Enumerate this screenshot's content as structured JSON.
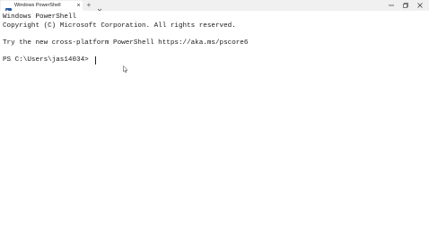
{
  "tab": {
    "title": "Windows PowerShell",
    "close_glyph": "×"
  },
  "tabbar": {
    "new_tab_glyph": "+"
  },
  "console": {
    "lines": [
      "Windows PowerShell",
      "Copyright (C) Microsoft Corporation. All rights reserved.",
      "Try the new cross-platform PowerShell https://aka.ms/pscore6",
      "PS C:\\Users\\jas14034> "
    ]
  },
  "icons": {
    "tab": "powershell-icon",
    "new_tab": "plus-icon",
    "dropdown": "chevron-down-icon",
    "minimize": "minimize-icon",
    "maximize": "maximize-icon",
    "close": "close-icon",
    "pointer": "mouse-pointer-icon"
  },
  "colors": {
    "titlebar": "#f0f0f0",
    "background": "#ffffff",
    "text": "#1a1a1a",
    "powershell_blue": "#2c5aa0"
  }
}
